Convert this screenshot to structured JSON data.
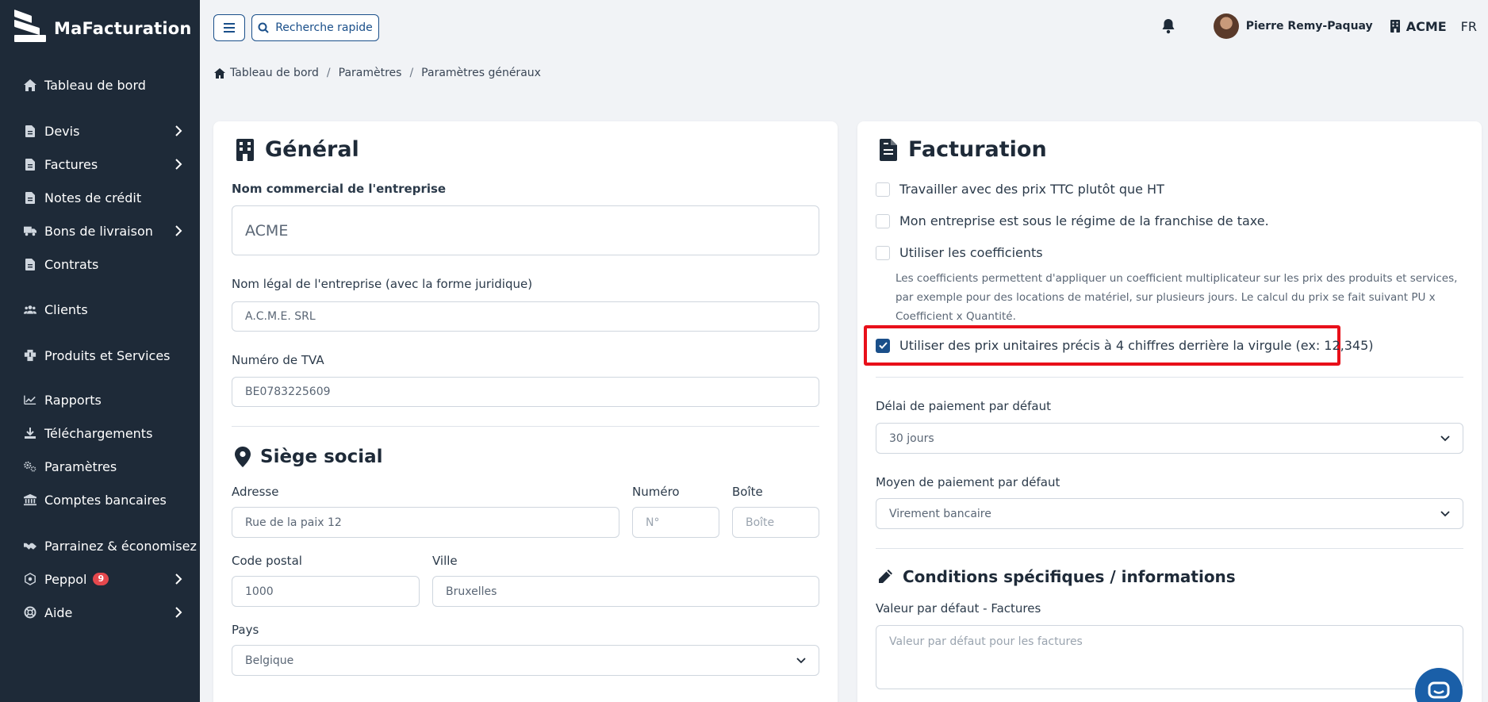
{
  "app": {
    "name": "MaFacturation"
  },
  "sidebar": {
    "items": [
      {
        "label": "Tableau de bord",
        "icon": "home-icon",
        "chevron": false
      },
      {
        "label": "Devis",
        "icon": "document-icon",
        "chevron": true
      },
      {
        "label": "Factures",
        "icon": "document-icon",
        "chevron": true
      },
      {
        "label": "Notes de crédit",
        "icon": "document-icon",
        "chevron": false
      },
      {
        "label": "Bons de livraison",
        "icon": "truck-icon",
        "chevron": true
      },
      {
        "label": "Contrats",
        "icon": "document-icon",
        "chevron": false
      },
      {
        "label": "Clients",
        "icon": "users-icon",
        "chevron": false
      },
      {
        "label": "Produits et Services",
        "icon": "box-icon",
        "chevron": false
      },
      {
        "label": "Rapports",
        "icon": "chart-icon",
        "chevron": false
      },
      {
        "label": "Téléchargements",
        "icon": "download-icon",
        "chevron": false
      },
      {
        "label": "Paramètres",
        "icon": "gears-icon",
        "chevron": false
      },
      {
        "label": "Comptes bancaires",
        "icon": "bank-icon",
        "chevron": false
      },
      {
        "label": "Parrainez & économisez",
        "icon": "handshake-icon",
        "chevron": false
      },
      {
        "label": "Peppol",
        "icon": "peppol-icon",
        "chevron": true,
        "badge": "9"
      },
      {
        "label": "Aide",
        "icon": "lifebuoy-icon",
        "chevron": true
      }
    ]
  },
  "topbar": {
    "search_label": "Recherche rapide",
    "user_name": "Pierre Remy-Paquay",
    "company": "ACME",
    "language": "FR"
  },
  "breadcrumb": [
    "Tableau de bord",
    "Paramètres",
    "Paramètres généraux"
  ],
  "general": {
    "title": "Général",
    "trade_name_label": "Nom commercial de l'entreprise",
    "trade_name_value": "ACME",
    "legal_name_label": "Nom légal de l'entreprise (avec la forme juridique)",
    "legal_name_value": "A.C.M.E. SRL",
    "vat_label": "Numéro de TVA",
    "vat_value": "BE0783225609"
  },
  "headquarters": {
    "title": "Siège social",
    "address_label": "Adresse",
    "address_value": "Rue de la paix 12",
    "number_label": "Numéro",
    "number_placeholder": "N°",
    "box_label": "Boîte",
    "box_placeholder": "Boîte",
    "postal_label": "Code postal",
    "postal_value": "1000",
    "city_label": "Ville",
    "city_value": "Bruxelles",
    "country_label": "Pays",
    "country_value": "Belgique"
  },
  "billing": {
    "title": "Facturation",
    "options": [
      {
        "label": "Travailler avec des prix TTC plutôt que HT",
        "checked": false
      },
      {
        "label": "Mon entreprise est sous le régime de la franchise de taxe.",
        "checked": false
      },
      {
        "label": "Utiliser les coefficients",
        "checked": false
      },
      {
        "label": "Utiliser des prix unitaires précis à 4 chiffres derrière la virgule (ex: 12,345)",
        "checked": true
      }
    ],
    "coefficients_help": "Les coefficients permettent d'appliquer un coefficient multiplicateur sur les prix des produits et services, par exemple pour des locations de matériel, sur plusieurs jours. Le calcul du prix se fait suivant PU x Coefficient x Quantité.",
    "payment_delay_label": "Délai de paiement par défaut",
    "payment_delay_value": "30 jours",
    "payment_method_label": "Moyen de paiement par défaut",
    "payment_method_value": "Virement bancaire"
  },
  "conditions": {
    "title": "Conditions spécifiques / informations",
    "invoices_default_label": "Valeur par défaut - Factures",
    "invoices_default_placeholder": "Valeur par défaut pour les factures"
  },
  "colors": {
    "sidebar_bg": "#1e2a38",
    "accent": "#1a4f8a",
    "highlight": "#e8101a",
    "badge": "#e5484d"
  }
}
